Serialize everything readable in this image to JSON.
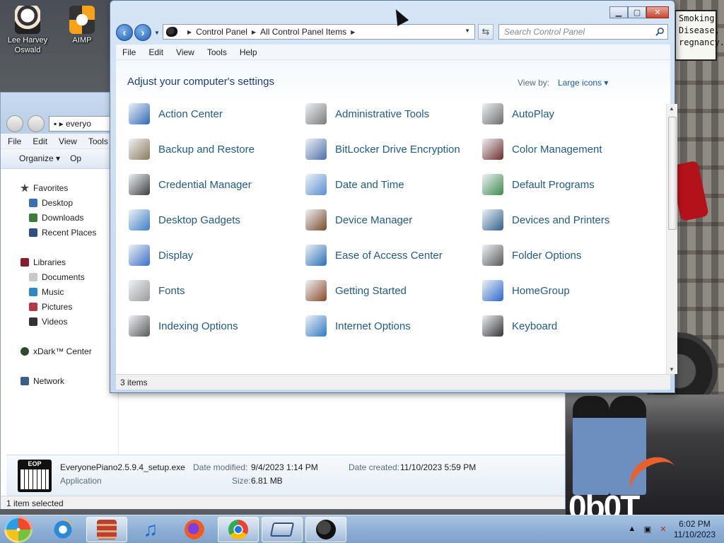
{
  "desktop": {
    "icons": [
      {
        "label": "Lee Harvey Oswald"
      },
      {
        "label": "AIMP"
      }
    ],
    "sign_text": [
      "Smoking",
      "Disease,",
      "regnancy."
    ],
    "logo_text": "0b0T"
  },
  "explorer": {
    "address_text": "everyo",
    "menu": [
      "File",
      "Edit",
      "View",
      "Tools"
    ],
    "toolbar": {
      "organize": "Organize ▾",
      "open": "Op"
    },
    "nav": {
      "favorites": "Favorites",
      "favorites_items": [
        "Desktop",
        "Downloads",
        "Recent Places"
      ],
      "libraries": "Libraries",
      "libraries_items": [
        "Documents",
        "Music",
        "Pictures",
        "Videos"
      ],
      "xdark": "xDark™ Center",
      "network": "Network"
    },
    "details": {
      "icon_text": "EOP",
      "filename": "EveryonePiano2.5.9.4_setup.exe",
      "type": "Application",
      "date_modified_label": "Date modified:",
      "date_modified": "9/4/2023 1:14 PM",
      "size_label": "Size:",
      "size": "6.81 MB",
      "date_created_label": "Date created:",
      "date_created": "11/10/2023 5:59 PM"
    },
    "status": "1 item selected"
  },
  "control_panel": {
    "breadcrumb": [
      "Control Panel",
      "All Control Panel Items"
    ],
    "search_placeholder": "Search Control Panel",
    "menu": [
      "File",
      "Edit",
      "View",
      "Tools",
      "Help"
    ],
    "heading": "Adjust your computer's settings",
    "view_by_label": "View by:",
    "view_by_value": "Large icons ▾",
    "items": [
      {
        "label": "Action Center",
        "icon": "flag-icon"
      },
      {
        "label": "Administrative Tools",
        "icon": "tools-icon"
      },
      {
        "label": "AutoPlay",
        "icon": "autoplay-icon"
      },
      {
        "label": "Backup and Restore",
        "icon": "backup-icon"
      },
      {
        "label": "BitLocker Drive Encryption",
        "icon": "lock-icon"
      },
      {
        "label": "Color Management",
        "icon": "color-icon"
      },
      {
        "label": "Credential Manager",
        "icon": "vault-icon"
      },
      {
        "label": "Date and Time",
        "icon": "calendar-clock-icon"
      },
      {
        "label": "Default Programs",
        "icon": "default-programs-icon"
      },
      {
        "label": "Desktop Gadgets",
        "icon": "gadgets-icon"
      },
      {
        "label": "Device Manager",
        "icon": "device-manager-icon"
      },
      {
        "label": "Devices and Printers",
        "icon": "printer-icon"
      },
      {
        "label": "Display",
        "icon": "monitor-icon"
      },
      {
        "label": "Ease of Access Center",
        "icon": "ease-access-icon"
      },
      {
        "label": "Folder Options",
        "icon": "folder-options-icon"
      },
      {
        "label": "Fonts",
        "icon": "fonts-icon"
      },
      {
        "label": "Getting Started",
        "icon": "house-icon"
      },
      {
        "label": "HomeGroup",
        "icon": "homegroup-icon"
      },
      {
        "label": "Indexing Options",
        "icon": "indexing-icon"
      },
      {
        "label": "Internet Options",
        "icon": "globe-icon"
      },
      {
        "label": "Keyboard",
        "icon": "keyboard-icon"
      }
    ],
    "status": "3 items"
  },
  "taskbar": {
    "clock_time": "6:02 PM",
    "clock_date": "11/10/2023"
  }
}
